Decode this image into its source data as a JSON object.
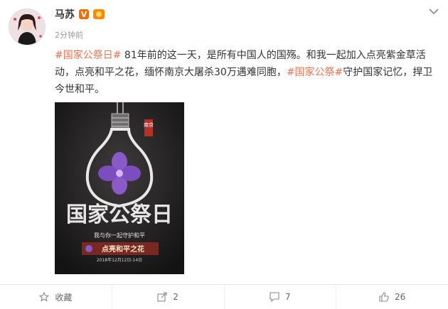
{
  "post": {
    "username": "马苏",
    "verified_badge": "V",
    "time": "2分钟前",
    "text_parts": [
      {
        "text": "#国家公祭日#",
        "tag": true
      },
      {
        "text": " 81年前的这一天，是所有中国人的国殇。和我一起加入点亮紫金草活动，点亮和平之花，缅怀南京大屠杀30万遇难同胞，",
        "tag": false
      },
      {
        "text": "#国家公祭#",
        "tag": true
      },
      {
        "text": "守护国家记忆，捍卫今世和平。",
        "tag": false
      }
    ]
  },
  "poster": {
    "side_label": "南京",
    "title": "国家公祭日",
    "subtitle": "我与你一起守护和平",
    "banner": "点亮和平之花",
    "date": "2018年12月12日-14日"
  },
  "footer": {
    "favorite_label": "收藏",
    "repost_count": "2",
    "comment_count": "7",
    "like_count": "26"
  },
  "colors": {
    "tag": "#eb7350",
    "flower": "#8a5ac9"
  }
}
